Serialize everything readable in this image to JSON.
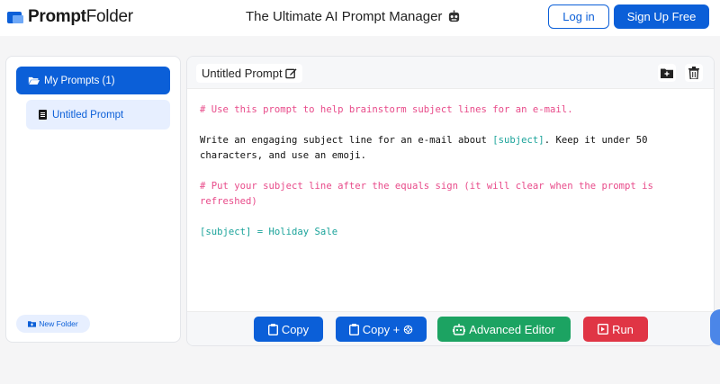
{
  "header": {
    "logo_bold": "Prompt",
    "logo_regular": "Folder",
    "app_title": "The Ultimate AI Prompt Manager",
    "login_label": "Log in",
    "signup_label": "Sign Up Free"
  },
  "sidebar": {
    "folder_label": "My Prompts (1)",
    "prompt_label": "Untitled Prompt",
    "new_folder_label": "New Folder"
  },
  "editor": {
    "title": "Untitled Prompt",
    "lines": {
      "comment1": "# Use this prompt to help brainstorm subject lines for an e-mail.",
      "body_before": "Write an engaging subject line for an e-mail about ",
      "body_var": "[subject]",
      "body_after": ". Keep it under 50 characters, and use an emoji.",
      "comment2": "# Put your subject line after the equals sign (it will clear when the prompt is refreshed)",
      "assignment": "[subject] = Holiday Sale"
    }
  },
  "footer": {
    "copy_label": "Copy",
    "copy_plus_label": "Copy +",
    "advanced_label": "Advanced Editor",
    "run_label": "Run"
  },
  "colors": {
    "primary": "#0b5fd8",
    "success": "#1ca362",
    "danger": "#e03545",
    "comment": "#e84b8a",
    "variable": "#1aa39a"
  }
}
